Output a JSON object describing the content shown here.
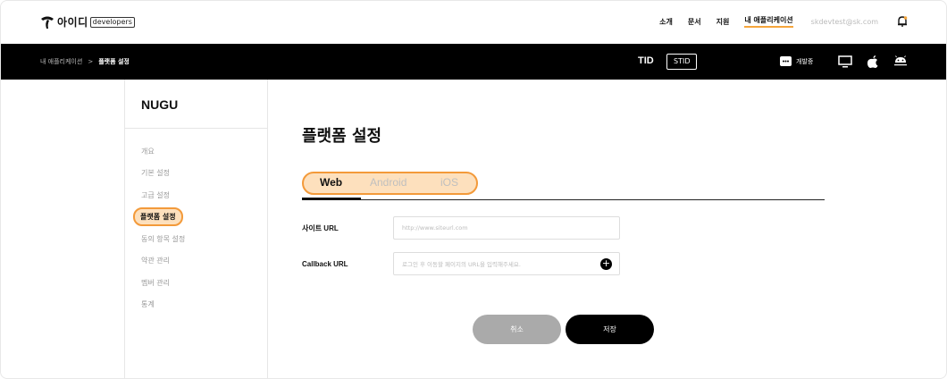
{
  "header": {
    "brand_name": "아이디",
    "brand_tag": "developers",
    "nav": [
      "소개",
      "문서",
      "지원",
      "내 애플리케이션"
    ],
    "active_nav": "내 애플리케이션",
    "user_email": "skdevtest@sk.com",
    "bell_icon": "bell-icon",
    "accent_color": "#f5a53b"
  },
  "subbar": {
    "breadcrumb_root": "내 애플리케이션",
    "breadcrumb_separator": ">",
    "breadcrumb_current": "플랫폼 설정",
    "tid_label": "TID",
    "stid_label": "STID",
    "dev_status": "개발중",
    "platform_icons": [
      "desktop-icon",
      "apple-icon",
      "android-icon"
    ]
  },
  "sidebar": {
    "app_name": "NUGU",
    "items": [
      {
        "label": "개요"
      },
      {
        "label": "기본 설정"
      },
      {
        "label": "고급 설정"
      },
      {
        "label": "플랫폼 설정"
      },
      {
        "label": "동의 항목 설정"
      },
      {
        "label": "약관 관리"
      },
      {
        "label": "멤버 관리"
      },
      {
        "label": "통계"
      }
    ],
    "active_item": "플랫폼 설정"
  },
  "main": {
    "title": "플랫폼 설정",
    "tabs": [
      {
        "label": "Web"
      },
      {
        "label": "Android"
      },
      {
        "label": "iOS"
      }
    ],
    "active_tab": "Web",
    "fields": [
      {
        "label": "사이트 URL",
        "placeholder": "http://www.siteurl.com",
        "value": ""
      },
      {
        "label": "Callback URL",
        "placeholder": "로그인 후 이동할 페이지의 URL을 입력해주세요.",
        "value": ""
      }
    ],
    "add_button_label": "+",
    "cancel_label": "취소",
    "save_label": "저장"
  },
  "colors": {
    "highlight_fill": "#fde0bd",
    "highlight_border": "#f39a3a",
    "cancel_button": "#aaaaaa",
    "save_button": "#000000"
  }
}
